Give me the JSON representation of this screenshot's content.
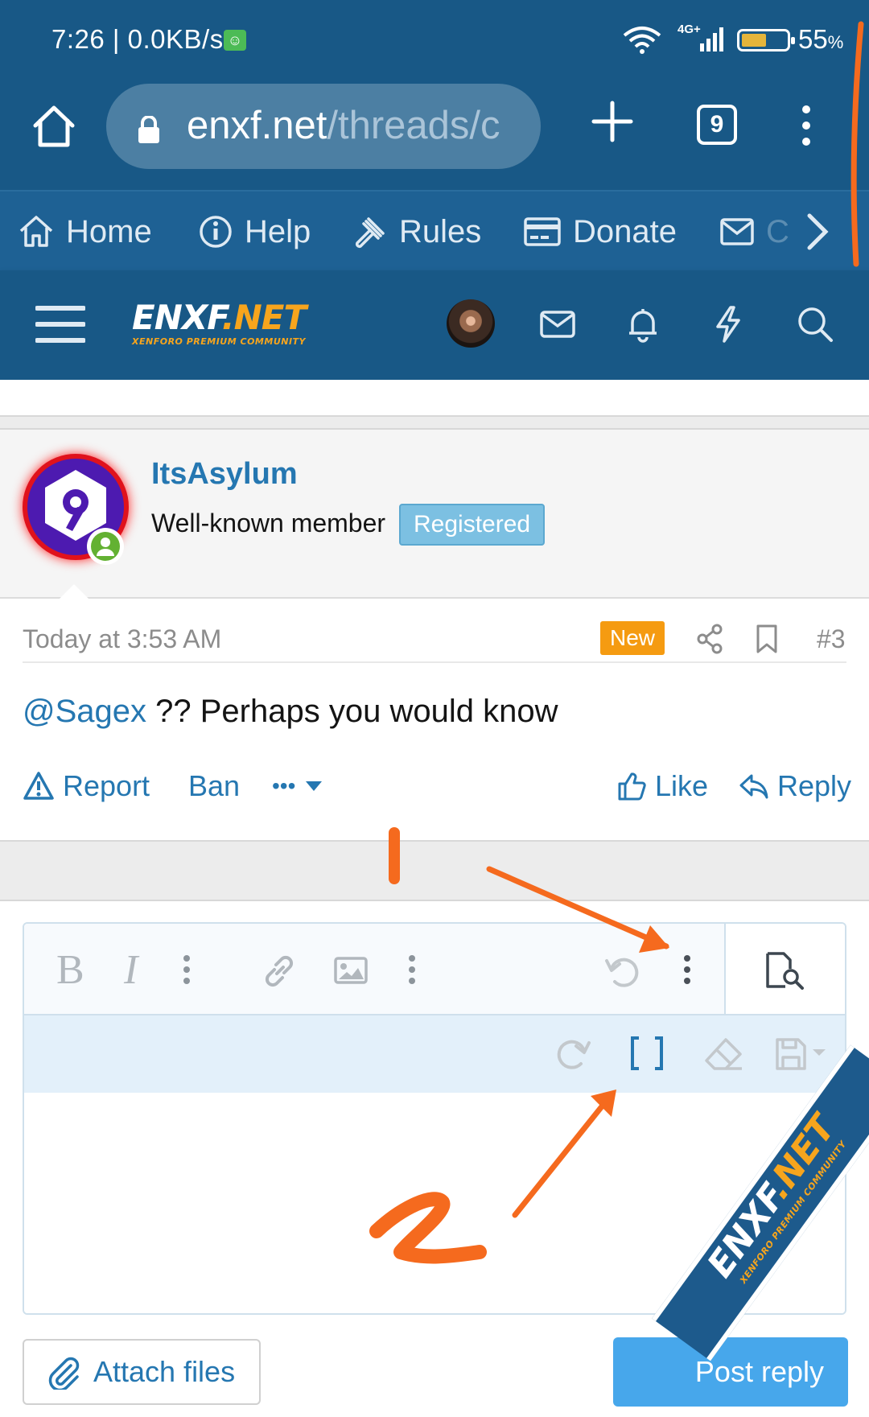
{
  "status_bar": {
    "time": "7:26 | 0.0KB/s",
    "network": "4G+",
    "battery_percent": "55",
    "battery_unit": "%",
    "battery_level": 0.55
  },
  "browser": {
    "url_host": "enxf.net",
    "url_path": "/threads/c",
    "tab_count": "9"
  },
  "site_nav": {
    "items": [
      {
        "label": "Home",
        "icon": "home-icon"
      },
      {
        "label": "Help",
        "icon": "info-icon"
      },
      {
        "label": "Rules",
        "icon": "gavel-icon"
      },
      {
        "label": "Donate",
        "icon": "credit-card-icon"
      },
      {
        "label": "C",
        "icon": "envelope-icon"
      }
    ]
  },
  "site_header": {
    "logo_main": "ENXF",
    "logo_dot": ".",
    "logo_net": "NET",
    "logo_sub": "XENFORO PREMIUM COMMUNITY"
  },
  "post": {
    "username": "ItsAsylum",
    "user_title": "Well-known member",
    "user_banner": "Registered",
    "date": "Today at 3:53 AM",
    "new_label": "New",
    "post_number": "#3",
    "mention": "@Sagex",
    "message": " ?? Perhaps you would know",
    "actions": {
      "report": "Report",
      "ban": "Ban",
      "more": "•••",
      "like": "Like",
      "reply": "Reply"
    }
  },
  "editor": {
    "toolbar_icons": [
      "bold-icon",
      "italic-icon",
      "more-text-options-icon",
      "link-icon",
      "image-icon",
      "more-insert-options-icon",
      "undo-icon",
      "more-options-icon",
      "preview-icon",
      "redo-icon",
      "bbcode-toggle-icon",
      "remove-format-icon",
      "drafts-icon"
    ]
  },
  "form": {
    "attach_label": "Attach files",
    "post_reply_label": "Post reply"
  },
  "annotations": {
    "marker_one": "1",
    "marker_two": "2",
    "color": "#f56a1e"
  },
  "watermark": {
    "main": "ENXF",
    "dot": ".",
    "net": "NET",
    "sub": "XENFORO PREMIUM COMMUNITY"
  },
  "colors": {
    "header_bg": "#185886",
    "nav_bg": "#1e6194",
    "link": "#2577b1",
    "accent": "#f7a51d",
    "new_badge": "#f59b11",
    "banner": "#7cc0e2",
    "button": "#47a7eb"
  }
}
